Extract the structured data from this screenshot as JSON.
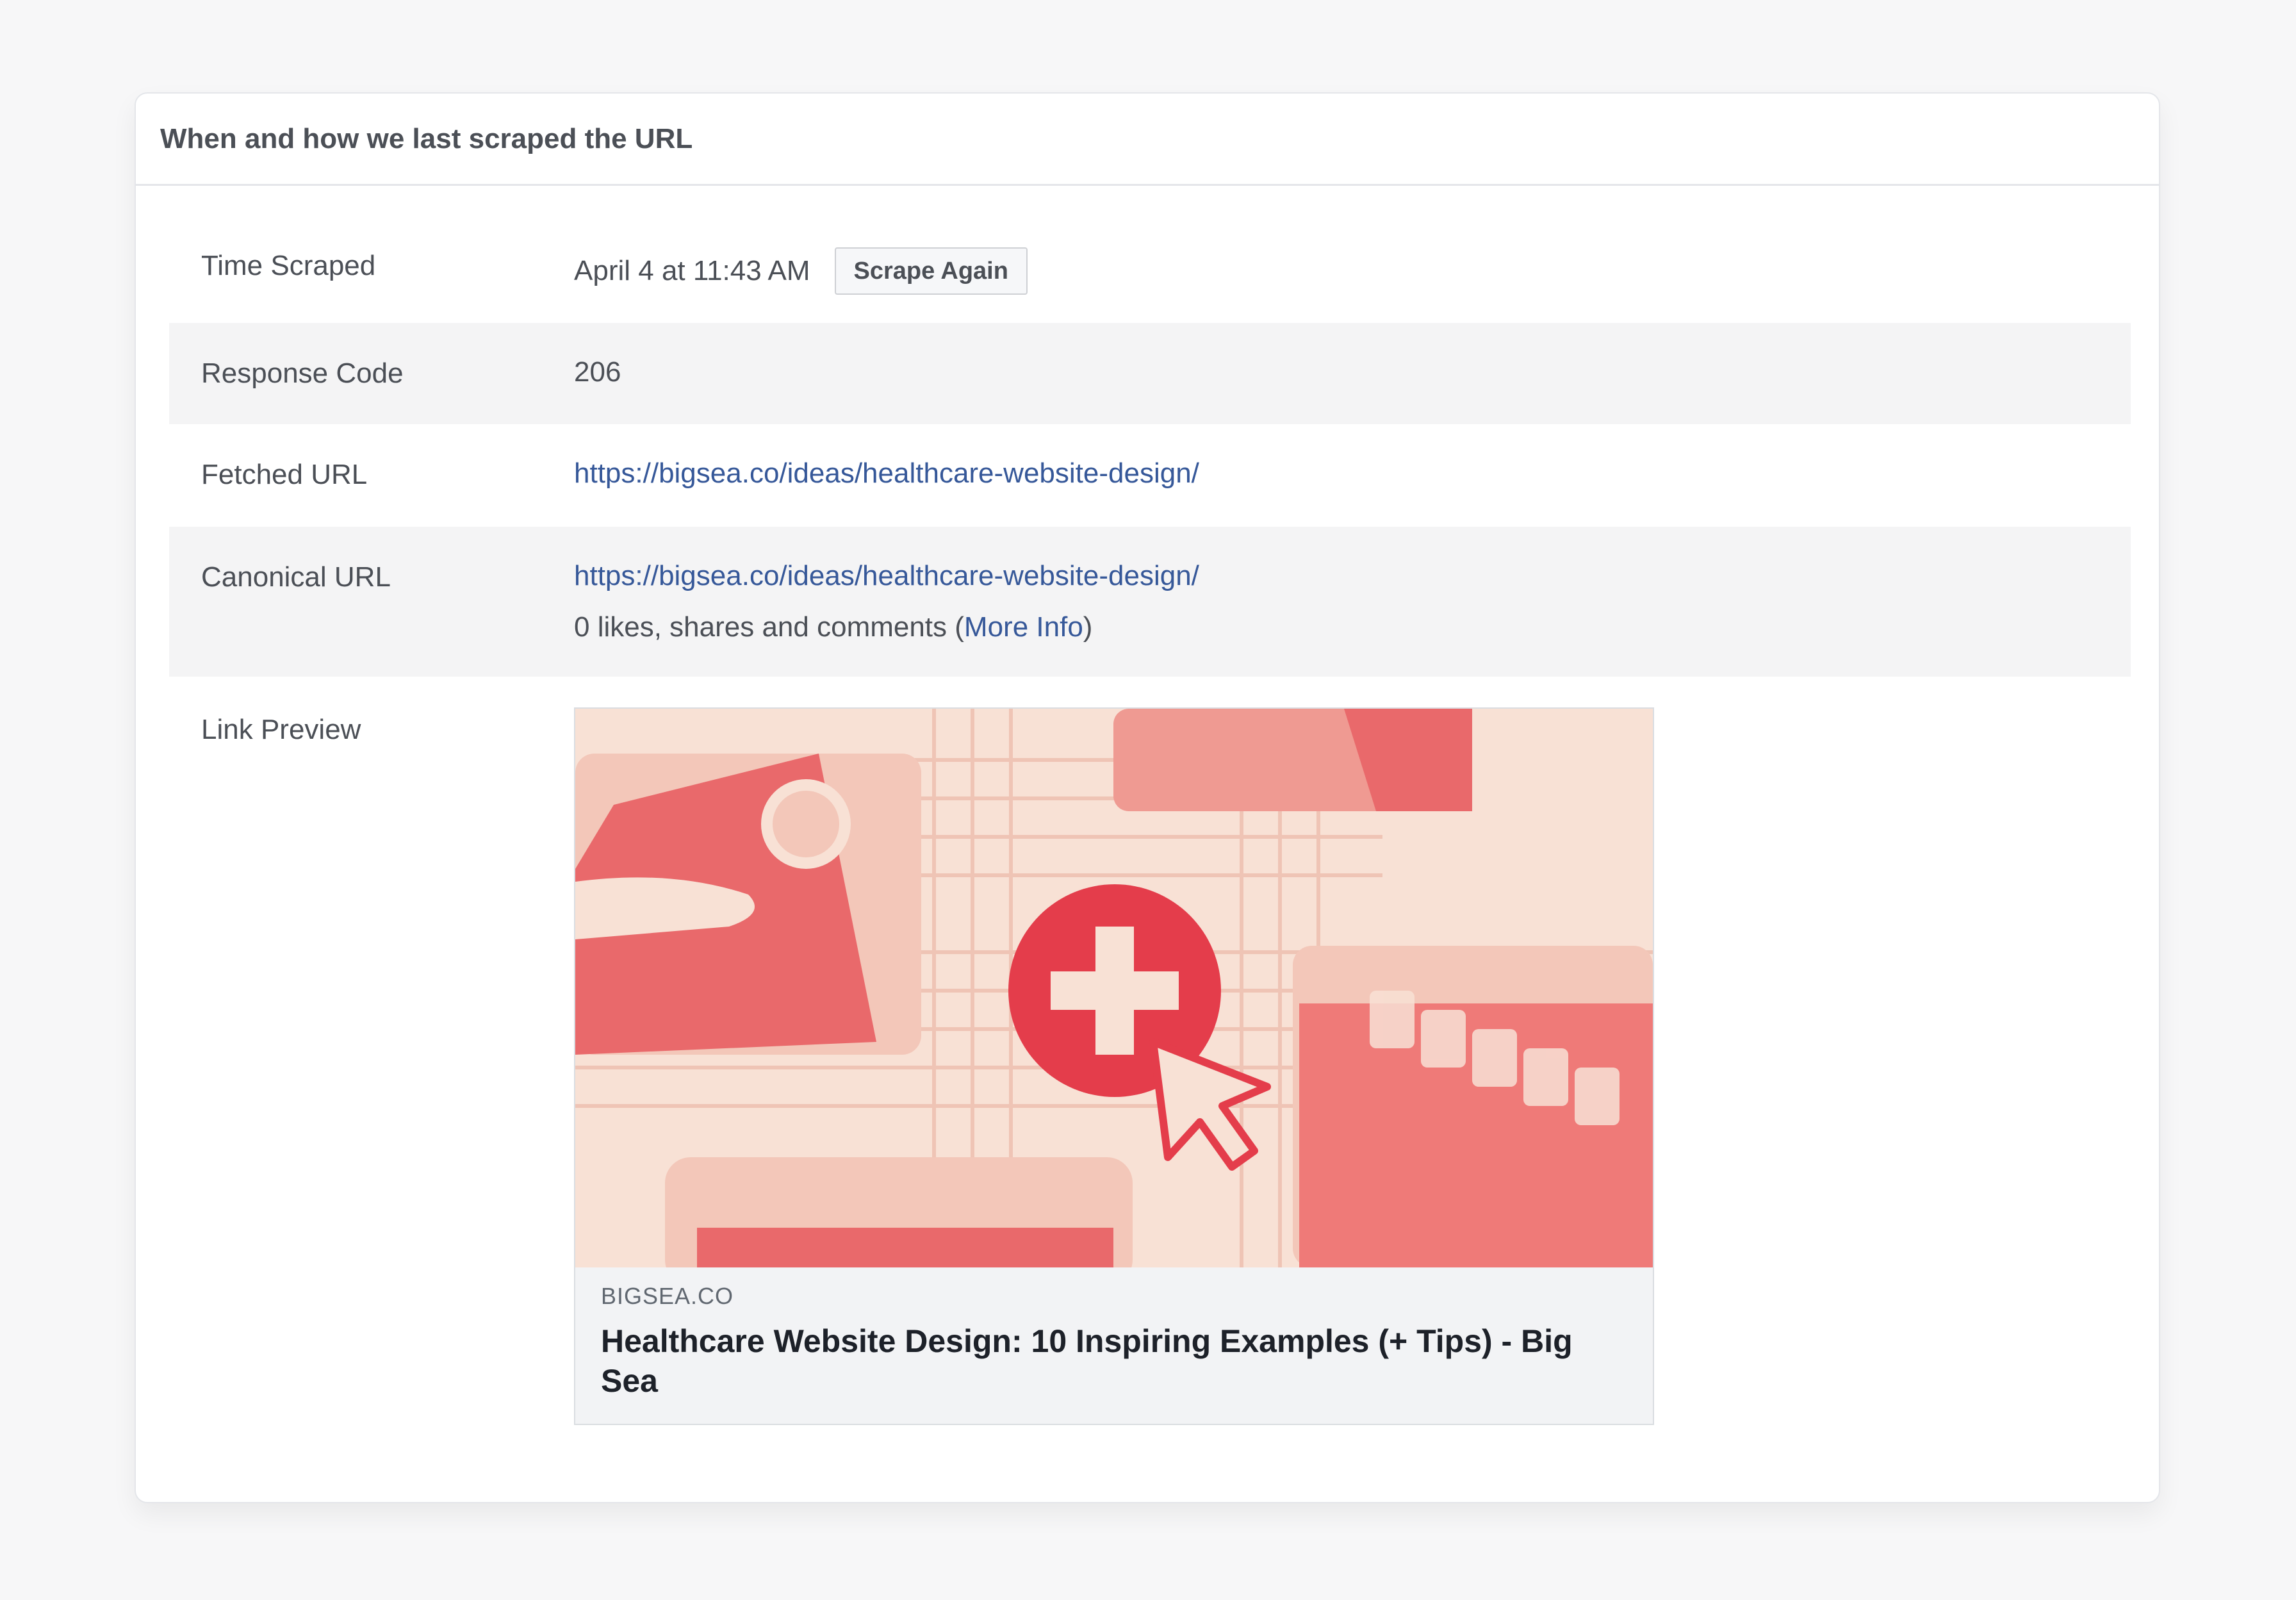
{
  "panel": {
    "title": "When and how we last scraped the URL"
  },
  "rows": {
    "time_scraped": {
      "label": "Time Scraped",
      "value": "April 4 at 11:43 AM",
      "button": "Scrape Again"
    },
    "response_code": {
      "label": "Response Code",
      "value": "206"
    },
    "fetched_url": {
      "label": "Fetched URL",
      "value": "https://bigsea.co/ideas/healthcare-website-design/"
    },
    "canonical_url": {
      "label": "Canonical URL",
      "value": "https://bigsea.co/ideas/healthcare-website-design/",
      "engagement_prefix": "0 likes, shares and comments (",
      "more_info": "More Info",
      "engagement_suffix": ")"
    },
    "link_preview": {
      "label": "Link Preview",
      "domain": "BIGSEA.CO",
      "title": "Healthcare Website Design: 10 Inspiring Examples (+ Tips) - Big Sea"
    }
  },
  "colors": {
    "link": "#365899",
    "label": "#4b4f56",
    "row_alt": "#f4f4f5",
    "preview_bg": "#f2f3f5",
    "illustration_red": "#e43d4b",
    "illustration_pink": "#ef7a78",
    "illustration_cream": "#f8e1d5"
  },
  "icons": {
    "medical_cross": "medical-cross-icon",
    "cursor": "cursor-arrow-icon"
  }
}
